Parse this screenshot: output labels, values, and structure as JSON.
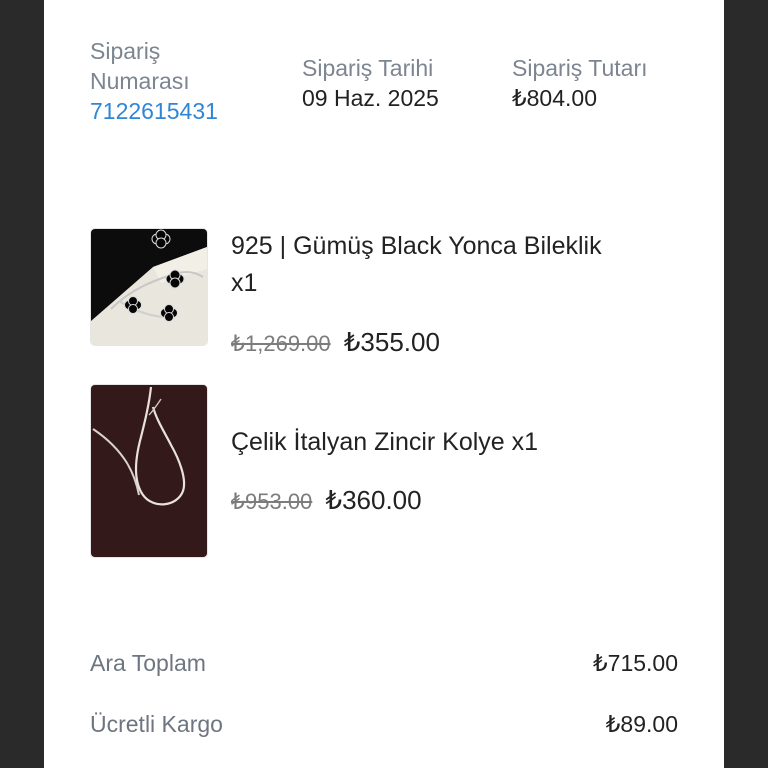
{
  "order": {
    "number_label_line1": "Sipariş",
    "number_label_line2": "Numarası",
    "number_value": "7122615431",
    "date_label": "Sipariş Tarihi",
    "date_value": "09 Haz. 2025",
    "total_label": "Sipariş Tutarı",
    "total_value": "₺804.00"
  },
  "products": [
    {
      "title_line1": "925 | Gümüş Black Yonca Bileklik",
      "title_line2": "x1",
      "old_price": "₺1,269.00",
      "new_price": "₺355.00",
      "thumb_icon": "bracelet-image"
    },
    {
      "title_line1": "Çelik İtalyan Zincir Kolye x1",
      "old_price": "₺953.00",
      "new_price": "₺360.00",
      "thumb_icon": "necklace-image"
    }
  ],
  "summary": {
    "subtotal_label": "Ara Toplam",
    "subtotal_value": "₺715.00",
    "shipping_label": "Ücretli Kargo",
    "shipping_value": "₺89.00"
  },
  "colors": {
    "accent": "#2f86d6",
    "background_outer": "#2a2a2a",
    "panel": "#ffffff",
    "muted_text": "#7c8591"
  }
}
